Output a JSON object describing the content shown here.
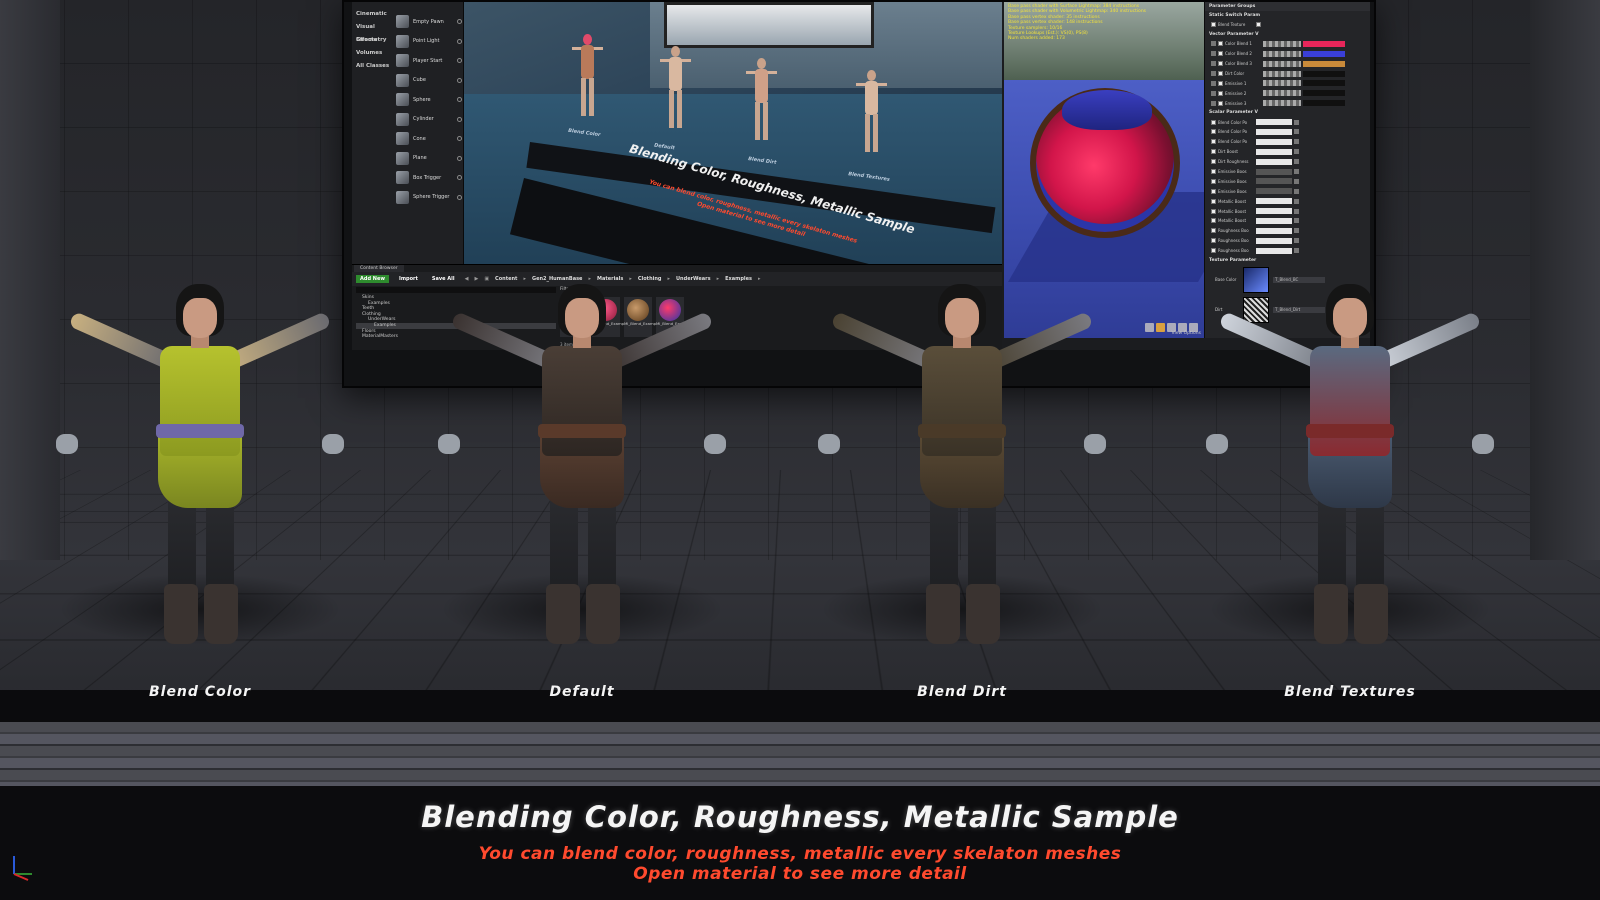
{
  "colors": {
    "accent_red": "#ff4a2e",
    "title_white": "#f5f5f5",
    "stat_yellow": "#f3e23a",
    "add_new_green": "#2e8b2e"
  },
  "place_actors": {
    "categories": [
      "Cinematic",
      "Visual Effects",
      "Geometry",
      "Volumes",
      "All Classes"
    ],
    "items": [
      {
        "label": "Empty Pawn",
        "icon": "pawn-icon"
      },
      {
        "label": "Point Light",
        "icon": "point-light-icon"
      },
      {
        "label": "Player Start",
        "icon": "player-start-icon"
      },
      {
        "label": "Cube",
        "icon": "cube-icon"
      },
      {
        "label": "Sphere",
        "icon": "sphere-icon"
      },
      {
        "label": "Cylinder",
        "icon": "cylinder-icon"
      },
      {
        "label": "Cone",
        "icon": "cone-icon"
      },
      {
        "label": "Plane",
        "icon": "plane-icon"
      },
      {
        "label": "Box Trigger",
        "icon": "box-trigger-icon"
      },
      {
        "label": "Sphere Trigger",
        "icon": "sphere-trigger-icon"
      }
    ]
  },
  "viewport": {
    "labels": [
      "Blend Color",
      "Default",
      "Blend Dirt",
      "Blend Textures"
    ],
    "title": "Blending Color, Roughness, Metallic Sample",
    "sub1": "You can blend color, roughness, metallic every skelaton meshes",
    "sub2": "Open material to see more detail"
  },
  "material_preview": {
    "stats": [
      "Base pass shader with Surface Lightmap: 384 instructions",
      "Base pass shader with Volumetric Lightmap: 340 instructions",
      "Base pass vertex shader: 35 instructions",
      "Base pass vertex shader: 148 instructions",
      "Texture samplers: 10/16",
      "Texture Lookups (Est.): VS(0), PS(8)",
      "Num shaders added: 173"
    ],
    "view_options": "View Options"
  },
  "details": {
    "sections": {
      "parameter_groups": "Parameter Groups",
      "static_switch": "Static Switch Param",
      "vector": "Vector Parameter V",
      "scalar": "Scalar Parameter V",
      "texture": "Texture Parameter"
    },
    "static_switch_rows": [
      "Blend Texture"
    ],
    "vector_rows": [
      {
        "label": "Color Blend 1",
        "color": "#e8265a"
      },
      {
        "label": "Color Blend 2",
        "color": "#3a3fd8"
      },
      {
        "label": "Color Blend 3",
        "color": "#c98a3a"
      },
      {
        "label": "Dirt Color",
        "color": "#101010"
      },
      {
        "label": "Emissive 1",
        "color": "#101010"
      },
      {
        "label": "Emissive 2",
        "color": "#101010"
      },
      {
        "label": "Emissive 3",
        "color": "#101010"
      }
    ],
    "scalar_rows": [
      {
        "label": "Blend Color Po",
        "dim": false
      },
      {
        "label": "Blend Color Po",
        "dim": false
      },
      {
        "label": "Blend Color Po",
        "dim": false
      },
      {
        "label": "Dirt Boost",
        "dim": false
      },
      {
        "label": "Dirt Roughness",
        "dim": false
      },
      {
        "label": "Emissive Boos",
        "dim": true
      },
      {
        "label": "Emissive Boos",
        "dim": true
      },
      {
        "label": "Emissive Boos",
        "dim": true
      },
      {
        "label": "Metallic Boost",
        "dim": false
      },
      {
        "label": "Metallic Boost",
        "dim": false
      },
      {
        "label": "Metallic Boost",
        "dim": false
      },
      {
        "label": "Roughness Boo",
        "dim": false
      },
      {
        "label": "Roughness Boo",
        "dim": false
      },
      {
        "label": "Roughness Boo",
        "dim": false
      }
    ],
    "texture_rows": [
      {
        "label": "Base Color",
        "file": "T_Blend_BC"
      },
      {
        "label": "Dirt",
        "file": "T_Blend_Dirt"
      }
    ]
  },
  "content_browser": {
    "tab": "Content Browser",
    "add_new": "Add New",
    "import": "Import",
    "save_all": "Save All",
    "breadcrumbs": [
      "Content",
      "Gen2_HumanBase",
      "Materials",
      "Clothing",
      "UnderWears",
      "Examples"
    ],
    "tree": [
      {
        "label": "Skins",
        "indent": 1,
        "selected": false
      },
      {
        "label": "Examples",
        "indent": 2,
        "selected": false
      },
      {
        "label": "Teeth",
        "indent": 1,
        "selected": false
      },
      {
        "label": "Clothing",
        "indent": 1,
        "selected": false
      },
      {
        "label": "UnderWears",
        "indent": 2,
        "selected": false
      },
      {
        "label": "Examples",
        "indent": 3,
        "selected": true
      },
      {
        "label": "Floors",
        "indent": 1,
        "selected": false
      },
      {
        "label": "MaterialMasters",
        "indent": 1,
        "selected": false
      }
    ],
    "filters": "Filters",
    "assets": [
      {
        "name": "MI_Blend_Example",
        "ball": "radial-gradient(circle at 40% 40%, #5a6cff, #1e2a9a)"
      },
      {
        "name": "MI_Blend_Example",
        "ball": "radial-gradient(circle at 40% 40%, #ff5a8a, #8a1a3a)"
      },
      {
        "name": "MI_Blend_Example",
        "ball": "radial-gradient(circle at 40% 40%, #c89a6a, #5a3a1a)"
      },
      {
        "name": "MI_Blend_Example",
        "ball": "radial-gradient(circle at 40% 40%, #ff3a6a, #2b36a8)"
      }
    ],
    "count": "3 items"
  },
  "characters": [
    {
      "label": "Blend Color",
      "torso": "linear-gradient(180deg,#b6c22e,#8c9a20)",
      "sleeve": "linear-gradient(90deg,#c8b080,#6a6a70)",
      "belt": "#6f68a8",
      "skirt": "linear-gradient(180deg,#a7b42a,#7a8620)"
    },
    {
      "label": "Default",
      "torso": "linear-gradient(180deg,#4a3e36,#2d2622)",
      "sleeve": "linear-gradient(90deg,#3a3230,#7a7a80)",
      "belt": "#5a3a2a",
      "skirt": "linear-gradient(180deg,#5a4032,#3a2a22)"
    },
    {
      "label": "Blend Dirt",
      "torso": "linear-gradient(180deg,#5a4e3a,#3a3226)",
      "sleeve": "linear-gradient(90deg,#4a4232,#7a7a80)",
      "belt": "#4a3a28",
      "skirt": "linear-gradient(180deg,#5a4a34,#3a3024)"
    },
    {
      "label": "Blend Textures",
      "torso": "linear-gradient(180deg,#5a6a80,#8a2a30)",
      "sleeve": "linear-gradient(90deg,#cfd4dc,#7a7f88)",
      "belt": "#7a2a2a",
      "skirt": "linear-gradient(180deg,#4a5a70,#2e3848)"
    }
  ],
  "bottom": {
    "title": "Blending Color, Roughness, Metallic Sample",
    "line1": "You can blend color, roughness, metallic every skelaton meshes",
    "line2": "Open material to see more detail"
  }
}
